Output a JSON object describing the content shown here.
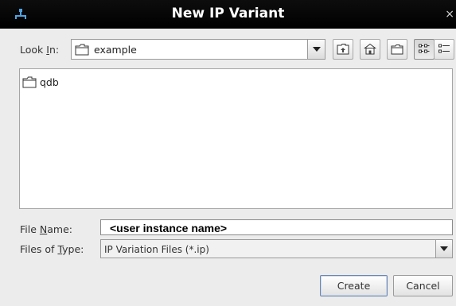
{
  "window": {
    "title": "New IP Variant",
    "close_glyph": "×"
  },
  "look_in": {
    "label_pre": "Look ",
    "label_mn": "I",
    "label_post": "n:",
    "value": "example",
    "icon": "folder-icon"
  },
  "toolbar": {
    "buttons": [
      "up-one-level-icon",
      "home-icon",
      "new-folder-icon",
      "list-view-icon",
      "details-view-icon"
    ]
  },
  "file_list": {
    "items": [
      {
        "name": "qdb",
        "icon": "folder-icon"
      }
    ]
  },
  "file_name": {
    "label_pre": "File ",
    "label_mn": "N",
    "label_post": "ame:",
    "value": "<user instance name>"
  },
  "files_of_type": {
    "label_pre": "Files of ",
    "label_mn": "T",
    "label_post": "ype:",
    "value": "IP Variation Files (*.ip)"
  },
  "buttons": {
    "create": "Create",
    "cancel": "Cancel"
  }
}
